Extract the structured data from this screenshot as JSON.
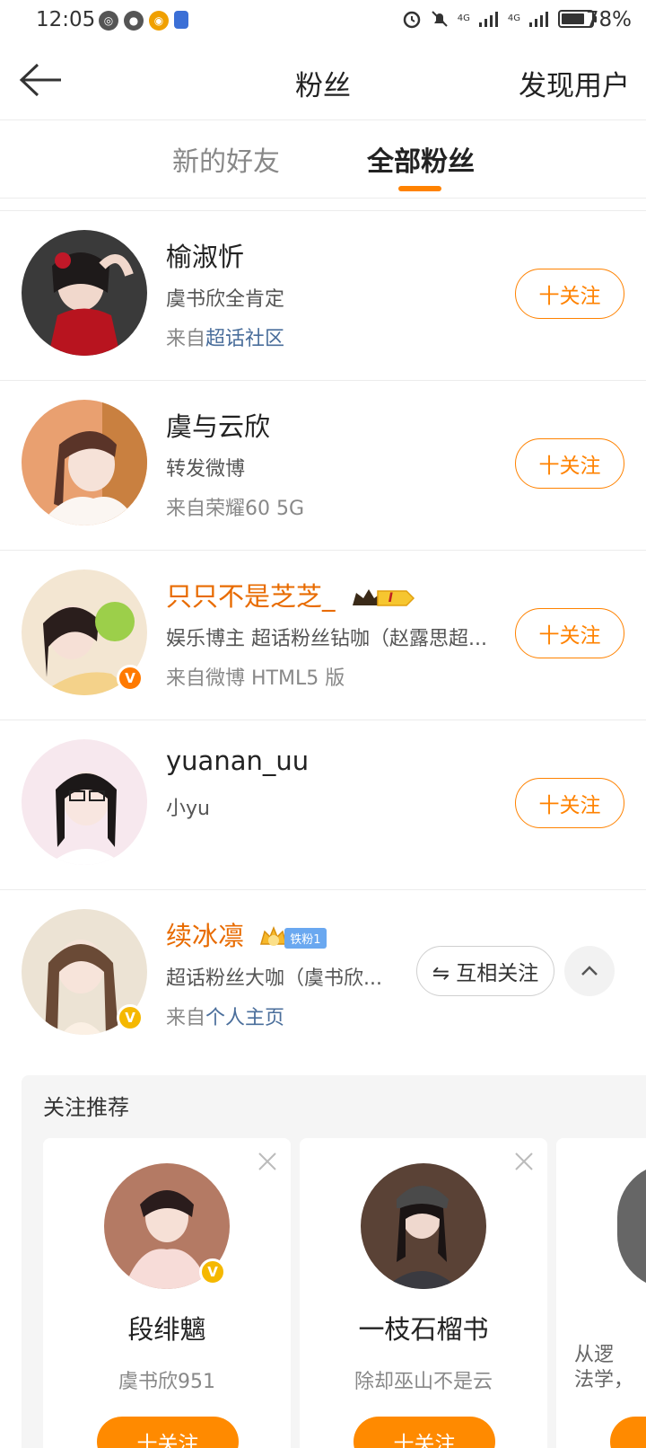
{
  "status_bar": {
    "time": "12:05",
    "battery_percent": "78%",
    "battery_level": 0.78,
    "network_1": "4G",
    "network_2": "4G",
    "left_icons": [
      "speed-icon",
      "wechat-icon",
      "weibo-icon",
      "shield-icon"
    ],
    "right_icons": [
      "alarm-icon",
      "mute-icon",
      "signal-icon",
      "signal-icon",
      "battery-icon"
    ]
  },
  "nav": {
    "title": "粉丝",
    "discover": "发现用户"
  },
  "tabs": {
    "new_friends": "新的好友",
    "all_fans": "全部粉丝",
    "active": "全部粉丝"
  },
  "fans": [
    {
      "name": "榆淑忻",
      "desc": "虞书欣全肯定",
      "source_prefix": "来自",
      "source_link": "超话社区",
      "follow": "十关注"
    },
    {
      "name": "虞与云欣",
      "desc": "转发微博",
      "source_prefix": "来自荣耀60 5G",
      "source_link": "",
      "follow": "十关注"
    },
    {
      "name": "只只不是芝芝_",
      "badge_level": "I",
      "desc": "娱乐博主 超话粉丝钻咖（赵露思超...",
      "source_prefix": "来自微博 HTML5 版",
      "source_link": "",
      "follow": "十关注",
      "verified": "V"
    },
    {
      "name": "yuanan_uu",
      "desc": "小yu",
      "source_prefix": "",
      "source_link": "",
      "follow": "十关注"
    },
    {
      "name": "续冰凛",
      "badge_label": "铁粉1",
      "desc": "超话粉丝大咖（虞书欣...",
      "source_prefix": "来自",
      "source_link": "个人主页",
      "mutual": "⇋ 互相关注",
      "verified": "V"
    }
  ],
  "recommend": {
    "title": "关注推荐",
    "cards": [
      {
        "name": "段绯魑",
        "desc": "虞书欣951",
        "follow": "十关注",
        "verified": "V"
      },
      {
        "name": "一枝石榴书",
        "desc": "除却巫山不是云",
        "follow": "十关注"
      },
      {
        "line1": "从逻",
        "line2": "法学，",
        "follow": ""
      }
    ]
  },
  "colors": {
    "accent": "#ff8200",
    "link": "#4a6e9b",
    "vip_name": "#e86b00",
    "verified_orange": "#ff7a00",
    "verified_gold": "#f5b800"
  }
}
